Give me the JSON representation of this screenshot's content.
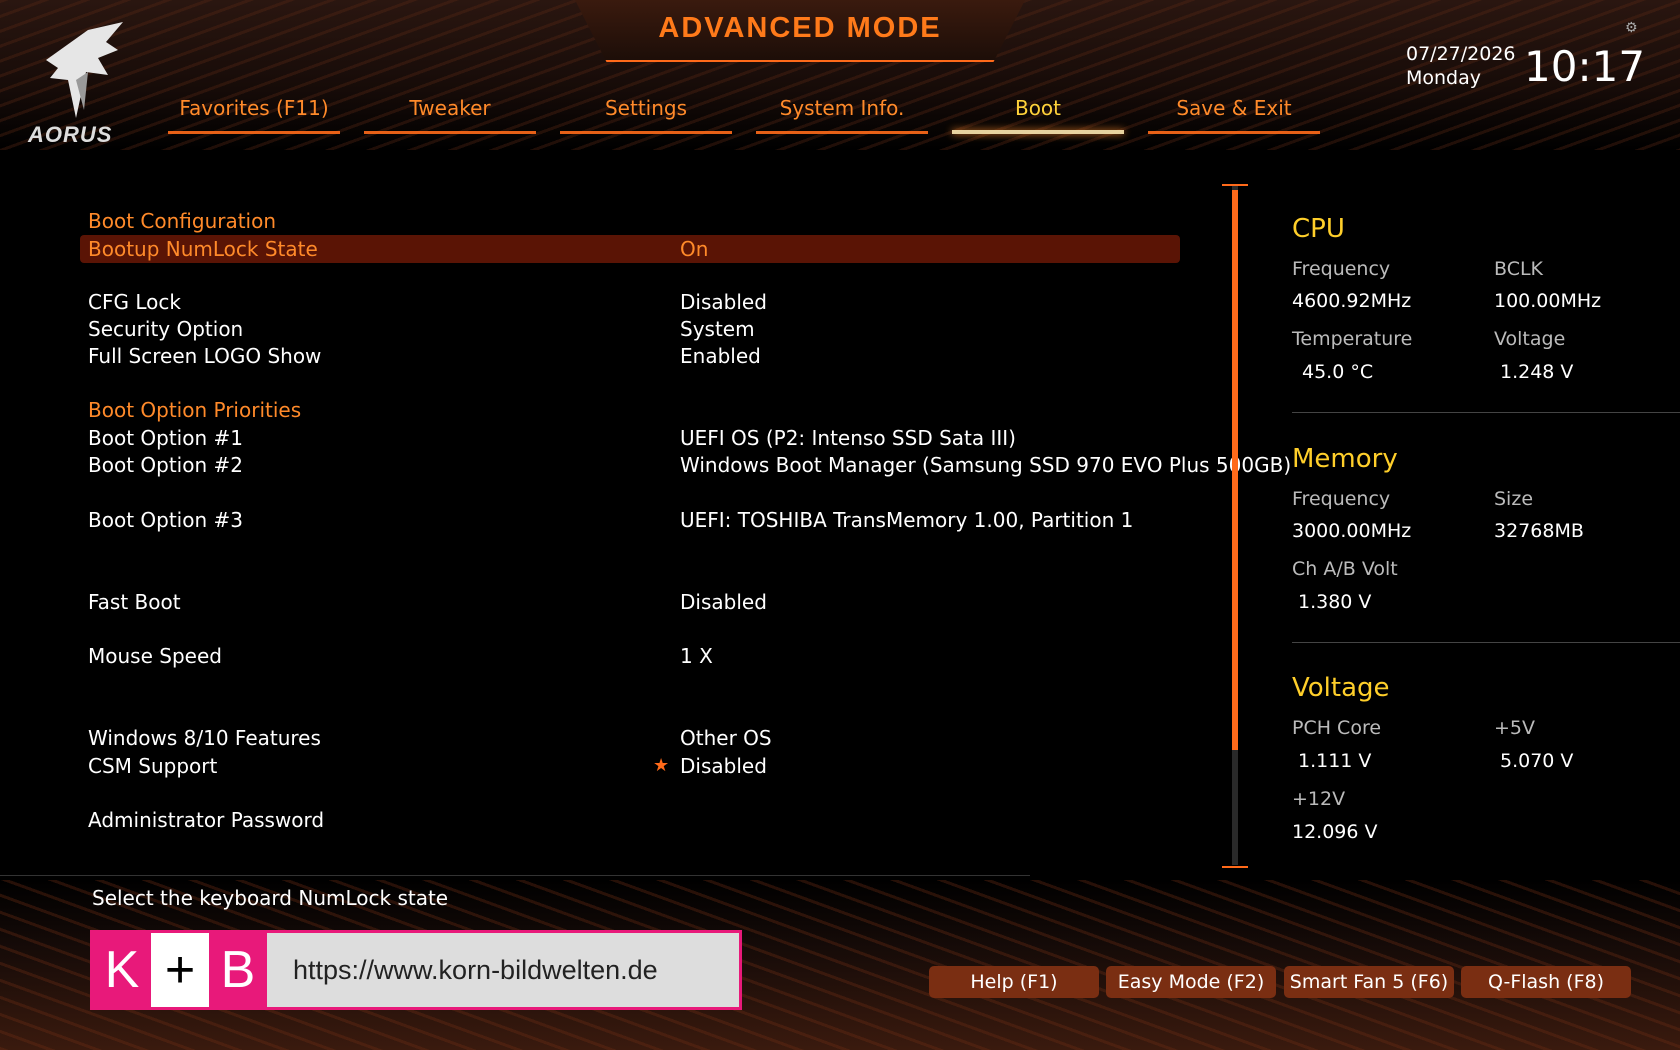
{
  "header": {
    "title": "ADVANCED MODE",
    "logo_text": "AORUS",
    "date": "07/27/2026",
    "weekday": "Monday",
    "time": "10:17"
  },
  "tabs": [
    {
      "label": "Favorites (F11)"
    },
    {
      "label": "Tweaker"
    },
    {
      "label": "Settings"
    },
    {
      "label": "System Info."
    },
    {
      "label": "Boot",
      "active": true
    },
    {
      "label": "Save & Exit"
    }
  ],
  "boot": {
    "section_config": "Boot Configuration",
    "numlock_label": "Bootup NumLock State",
    "numlock_value": "On",
    "cfg_lock_label": "CFG Lock",
    "cfg_lock_value": "Disabled",
    "security_label": "Security Option",
    "security_value": "System",
    "logo_show_label": "Full Screen LOGO Show",
    "logo_show_value": "Enabled",
    "section_priorities": "Boot Option Priorities",
    "opt1_label": "Boot Option #1",
    "opt1_value": "UEFI OS (P2: Intenso SSD Sata III)",
    "opt2_label": "Boot Option #2",
    "opt2_value": "Windows Boot Manager (Samsung SSD 970 EVO Plus 500GB)",
    "opt3_label": "Boot Option #3",
    "opt3_value": "UEFI: TOSHIBA TransMemory 1.00, Partition 1",
    "fast_boot_label": "Fast Boot",
    "fast_boot_value": "Disabled",
    "mouse_speed_label": "Mouse Speed",
    "mouse_speed_value": "1 X",
    "win_features_label": "Windows 8/10 Features",
    "win_features_value": "Other OS",
    "csm_label": "CSM Support",
    "csm_value": "Disabled",
    "admin_pw_label": "Administrator Password"
  },
  "scrollbar": {
    "visible_fraction": 0.83
  },
  "monitor": {
    "cpu_title": "CPU",
    "cpu_freq_label": "Frequency",
    "cpu_freq_value": "4600.92MHz",
    "bclk_label": "BCLK",
    "bclk_value": "100.00MHz",
    "temp_label": "Temperature",
    "temp_value": "45.0 °C",
    "cpu_volt_label": "Voltage",
    "cpu_volt_value": "1.248 V",
    "mem_title": "Memory",
    "mem_freq_label": "Frequency",
    "mem_freq_value": "3000.00MHz",
    "mem_size_label": "Size",
    "mem_size_value": "32768MB",
    "mem_volt_label": "Ch A/B Volt",
    "mem_volt_value": "1.380 V",
    "volt_title": "Voltage",
    "pch_label": "PCH Core",
    "pch_value": "1.111 V",
    "v5_label": "+5V",
    "v5_value": "5.070 V",
    "v12_label": "+12V",
    "v12_value": "12.096 V"
  },
  "help_text": "Select the keyboard NumLock state",
  "watermark": {
    "k": "K",
    "plus": "+",
    "b": "B",
    "url": "https://www.korn-bildwelten.de"
  },
  "footer_buttons": [
    {
      "label": "Help (F1)"
    },
    {
      "label": "Easy Mode (F2)"
    },
    {
      "label": "Smart Fan 5 (F6)"
    },
    {
      "label": "Q-Flash (F8)"
    }
  ],
  "colors": {
    "accent": "#ff6a1a",
    "label_orange": "#ff8a2a",
    "section_yellow": "#ffcf2a",
    "selected_row": "#5a1405"
  }
}
